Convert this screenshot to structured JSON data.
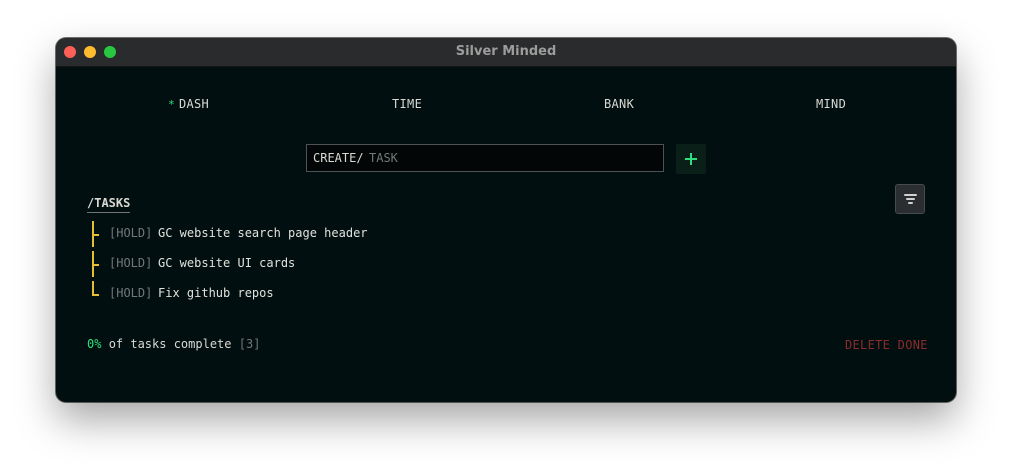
{
  "window": {
    "title": "Silver Minded"
  },
  "nav": {
    "items": [
      {
        "label": "DASH",
        "active": true,
        "marker": "*"
      },
      {
        "label": "TIME"
      },
      {
        "label": "BANK"
      },
      {
        "label": "MIND"
      }
    ]
  },
  "create": {
    "label": "CREATE/",
    "placeholder": "TASK",
    "value": ""
  },
  "tasks": {
    "heading": "/TASKS",
    "items": [
      {
        "status": "[HOLD]",
        "title": "GC website search page header"
      },
      {
        "status": "[HOLD]",
        "title": "GC website UI cards"
      },
      {
        "status": "[HOLD]",
        "title": "Fix github repos"
      }
    ]
  },
  "summary": {
    "percent": "0%",
    "text": "of tasks complete",
    "count": "[3]"
  },
  "actions": {
    "delete_done": "DELETE DONE"
  },
  "colors": {
    "background": "#010f10",
    "accent": "#2ee07d",
    "tree": "#e5c02e",
    "danger": "#8c2b2b",
    "muted": "#73787a"
  },
  "icons": {
    "add": "plus-icon",
    "filter": "filter-icon",
    "active_nav": "star-icon"
  }
}
